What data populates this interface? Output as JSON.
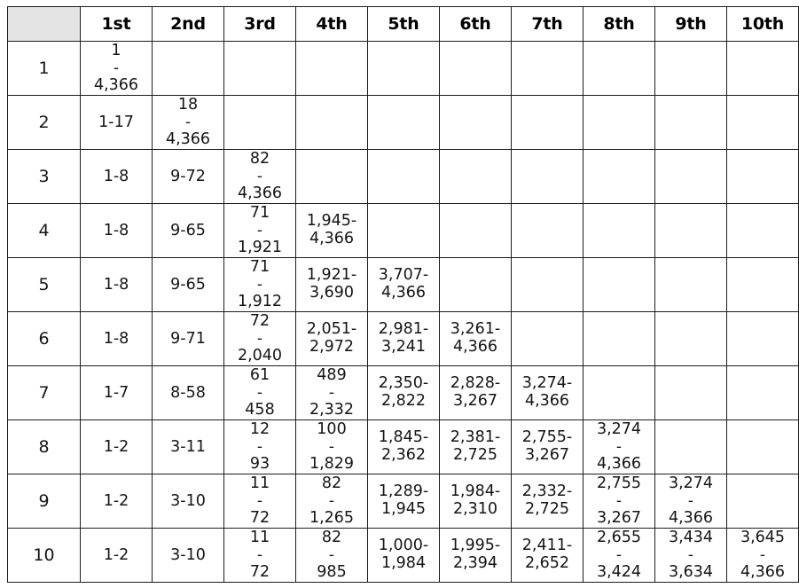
{
  "table": {
    "corner_label": "",
    "column_headers": [
      "1st",
      "2nd",
      "3rd",
      "4th",
      "5th",
      "6th",
      "7th",
      "8th",
      "9th",
      "10th"
    ],
    "row_labels": [
      "1",
      "2",
      "3",
      "4",
      "5",
      "6",
      "7",
      "8",
      "9",
      "10"
    ],
    "rows": [
      {
        "label": "1",
        "cells": [
          {
            "style": "stack3",
            "lo": "1",
            "dash": "-",
            "hi": "4,366"
          },
          {
            "style": "empty"
          },
          {
            "style": "empty"
          },
          {
            "style": "empty"
          },
          {
            "style": "empty"
          },
          {
            "style": "empty"
          },
          {
            "style": "empty"
          },
          {
            "style": "empty"
          },
          {
            "style": "empty"
          },
          {
            "style": "empty"
          }
        ]
      },
      {
        "label": "2",
        "cells": [
          {
            "style": "one",
            "text": "1-17"
          },
          {
            "style": "stack3",
            "lo": "18",
            "dash": "-",
            "hi": "4,366"
          },
          {
            "style": "empty"
          },
          {
            "style": "empty"
          },
          {
            "style": "empty"
          },
          {
            "style": "empty"
          },
          {
            "style": "empty"
          },
          {
            "style": "empty"
          },
          {
            "style": "empty"
          },
          {
            "style": "empty"
          }
        ]
      },
      {
        "label": "3",
        "cells": [
          {
            "style": "one",
            "text": "1-8"
          },
          {
            "style": "one",
            "text": "9-72"
          },
          {
            "style": "stack3",
            "lo": "82",
            "dash": "-",
            "hi": "4,366"
          },
          {
            "style": "empty"
          },
          {
            "style": "empty"
          },
          {
            "style": "empty"
          },
          {
            "style": "empty"
          },
          {
            "style": "empty"
          },
          {
            "style": "empty"
          },
          {
            "style": "empty"
          }
        ]
      },
      {
        "label": "4",
        "cells": [
          {
            "style": "one",
            "text": "1-8"
          },
          {
            "style": "one",
            "text": "9-65"
          },
          {
            "style": "stack3",
            "lo": "71",
            "dash": "-",
            "hi": "1,921"
          },
          {
            "style": "stack2",
            "lo": "1,945-",
            "hi": "4,366"
          },
          {
            "style": "empty"
          },
          {
            "style": "empty"
          },
          {
            "style": "empty"
          },
          {
            "style": "empty"
          },
          {
            "style": "empty"
          },
          {
            "style": "empty"
          }
        ]
      },
      {
        "label": "5",
        "cells": [
          {
            "style": "one",
            "text": "1-8"
          },
          {
            "style": "one",
            "text": "9-65"
          },
          {
            "style": "stack3",
            "lo": "71",
            "dash": "-",
            "hi": "1,912"
          },
          {
            "style": "stack2",
            "lo": "1,921-",
            "hi": "3,690"
          },
          {
            "style": "stack2",
            "lo": "3,707-",
            "hi": "4,366"
          },
          {
            "style": "empty"
          },
          {
            "style": "empty"
          },
          {
            "style": "empty"
          },
          {
            "style": "empty"
          },
          {
            "style": "empty"
          }
        ]
      },
      {
        "label": "6",
        "cells": [
          {
            "style": "one",
            "text": "1-8"
          },
          {
            "style": "one",
            "text": "9-71"
          },
          {
            "style": "stack3",
            "lo": "72",
            "dash": "-",
            "hi": "2,040"
          },
          {
            "style": "stack2",
            "lo": "2,051-",
            "hi": "2,972"
          },
          {
            "style": "stack2",
            "lo": "2,981-",
            "hi": "3,241"
          },
          {
            "style": "stack2",
            "lo": "3,261-",
            "hi": "4,366"
          },
          {
            "style": "empty"
          },
          {
            "style": "empty"
          },
          {
            "style": "empty"
          },
          {
            "style": "empty"
          }
        ]
      },
      {
        "label": "7",
        "cells": [
          {
            "style": "one",
            "text": "1-7"
          },
          {
            "style": "one",
            "text": "8-58"
          },
          {
            "style": "stack3",
            "lo": "61",
            "dash": "-",
            "hi": "458"
          },
          {
            "style": "stack3",
            "lo": "489",
            "dash": "-",
            "hi": "2,332"
          },
          {
            "style": "stack2",
            "lo": "2,350-",
            "hi": "2,822"
          },
          {
            "style": "stack2",
            "lo": "2,828-",
            "hi": "3,267"
          },
          {
            "style": "stack2",
            "lo": "3,274-",
            "hi": "4,366"
          },
          {
            "style": "empty"
          },
          {
            "style": "empty"
          },
          {
            "style": "empty"
          }
        ]
      },
      {
        "label": "8",
        "cells": [
          {
            "style": "one",
            "text": "1-2"
          },
          {
            "style": "one",
            "text": "3-11"
          },
          {
            "style": "stack3",
            "lo": "12",
            "dash": "-",
            "hi": "93"
          },
          {
            "style": "stack3",
            "lo": "100",
            "dash": "-",
            "hi": "1,829"
          },
          {
            "style": "stack2",
            "lo": "1,845-",
            "hi": "2,362"
          },
          {
            "style": "stack2",
            "lo": "2,381-",
            "hi": "2,725"
          },
          {
            "style": "stack2",
            "lo": "2,755-",
            "hi": "3,267"
          },
          {
            "style": "stack3",
            "lo": "3,274",
            "dash": "-",
            "hi": "4,366"
          },
          {
            "style": "empty"
          },
          {
            "style": "empty"
          }
        ]
      },
      {
        "label": "9",
        "cells": [
          {
            "style": "one",
            "text": "1-2"
          },
          {
            "style": "one",
            "text": "3-10"
          },
          {
            "style": "stack3",
            "lo": "11",
            "dash": "-",
            "hi": "72"
          },
          {
            "style": "stack3",
            "lo": "82",
            "dash": "-",
            "hi": "1,265"
          },
          {
            "style": "stack2",
            "lo": "1,289-",
            "hi": "1,945"
          },
          {
            "style": "stack2",
            "lo": "1,984-",
            "hi": "2,310"
          },
          {
            "style": "stack2",
            "lo": "2,332-",
            "hi": "2,725"
          },
          {
            "style": "stack3",
            "lo": "2,755",
            "dash": "-",
            "hi": "3,267"
          },
          {
            "style": "stack3",
            "lo": "3,274",
            "dash": "-",
            "hi": "4,366"
          },
          {
            "style": "empty"
          }
        ]
      },
      {
        "label": "10",
        "cells": [
          {
            "style": "one",
            "text": "1-2"
          },
          {
            "style": "one",
            "text": "3-10"
          },
          {
            "style": "stack3",
            "lo": "11",
            "dash": "-",
            "hi": "72"
          },
          {
            "style": "stack3",
            "lo": "82",
            "dash": "-",
            "hi": "985"
          },
          {
            "style": "stack2",
            "lo": "1,000-",
            "hi": "1,984"
          },
          {
            "style": "stack2",
            "lo": "1,995-",
            "hi": "2,394"
          },
          {
            "style": "stack2",
            "lo": "2,411-",
            "hi": "2,652"
          },
          {
            "style": "stack3",
            "lo": "2,655",
            "dash": "-",
            "hi": "3,424"
          },
          {
            "style": "stack3",
            "lo": "3,434",
            "dash": "-",
            "hi": "3,634"
          },
          {
            "style": "stack3",
            "lo": "3,645",
            "dash": "-",
            "hi": "4,366"
          }
        ]
      }
    ]
  },
  "colors": {
    "header_background": "#e4e4e4",
    "border": "#1c1c1c",
    "text": "#151515",
    "page_background": "#ffffff"
  }
}
